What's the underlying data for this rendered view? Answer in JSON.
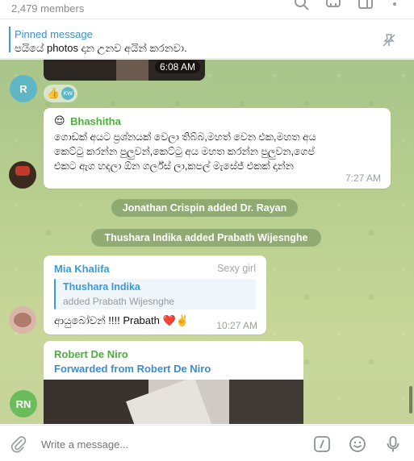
{
  "header": {
    "members": "2,479 members",
    "icons": [
      "search-icon",
      "voice-chat-icon",
      "sidebar-icon",
      "more-icon"
    ]
  },
  "pinned": {
    "title": "Pinned message",
    "text": "පයියේ photos දාන උනව අයින් කරනවා."
  },
  "messages": {
    "photo_time": "6:08 AM",
    "r_avatar": "R",
    "reaction_badge": "KW",
    "bhashitha": {
      "emoji": "😌",
      "name": "Bhashitha",
      "line1": "ගොඩක් අයට ප්‍රශ්නයක් වෙලා තිබ්බ,මහත් වෙන එක,මහත අය",
      "line2": "කෙට්ටු කරන්න පුලුවන්,කෙට්ටු අය මහත කරන්න පුලුවන,ගෙප්",
      "line3": "එකට ඇග හදලා ඕන ගර්ල්ස් ලා,කපල් මැසේජ් එකක් දාන්න",
      "time": "7:27 AM"
    },
    "service1": "Jonathan Crispin added Dr. Rayan",
    "service2": "Thushara Indika added Prabath Wijesnghe",
    "mia": {
      "name": "Mia Khalifa",
      "rank": "Sexy girl",
      "reply_name": "Thushara Indika",
      "reply_text": "added Prabath Wijesnghe",
      "text": "ආයුබෝවන් !!!! Prabath ❤️✌️",
      "time": "10:27 AM"
    },
    "robert": {
      "name": "Robert De Niro",
      "forwarded": "Forwarded from Robert De Niro",
      "avatar": "RN"
    }
  },
  "input": {
    "placeholder": "Write a message..."
  },
  "colors": {
    "accent": "#3a8ed0",
    "bhashitha_name": "#4cae3b",
    "mia_name": "#3a9ad9",
    "robert_name": "#4cae3b",
    "r_avatar": "#5fb7c6",
    "rn_avatar": "#6bbd5b"
  }
}
